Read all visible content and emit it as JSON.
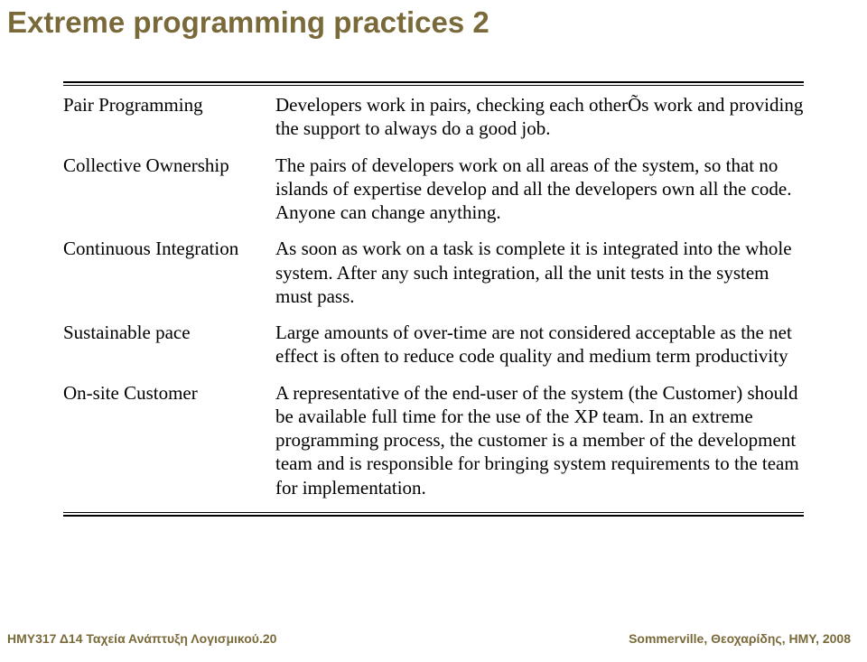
{
  "title": "Extreme programming practices 2",
  "rows": [
    {
      "label": "Pair Programming",
      "desc": "Developers work in pairs, checking each otherÕs work and providing the support to always do a good job."
    },
    {
      "label": "Collective Ownership",
      "desc": "The pairs of developers work on all areas of the system, so that no islands of expertise develop and all the developers own all the code. Anyone can change anything."
    },
    {
      "label": "Continuous Integration",
      "desc": "As soon as work on a task is complete it is integrated into the whole system. After any such integration, all the unit tests in the system must pass."
    },
    {
      "label": "Sustainable pace",
      "desc": "Large amounts of over-time are not considered acceptable as the net effect is often to reduce code quality and medium term productivity"
    },
    {
      "label": "On-site Customer",
      "desc": "A representative of the end-user of the system (the Customer) should be available full time for the use of the XP team. In an extreme programming process, the customer is a member of the development team and is responsible for bringing system requirements to the team for implementation."
    }
  ],
  "footer_left": "ΗΜΥ317  Δ14 Ταχεία Ανάπτυξη Λογισμικού.20",
  "footer_right": "Sommerville, Θεοχαρίδης, ΗΜΥ, 2008"
}
